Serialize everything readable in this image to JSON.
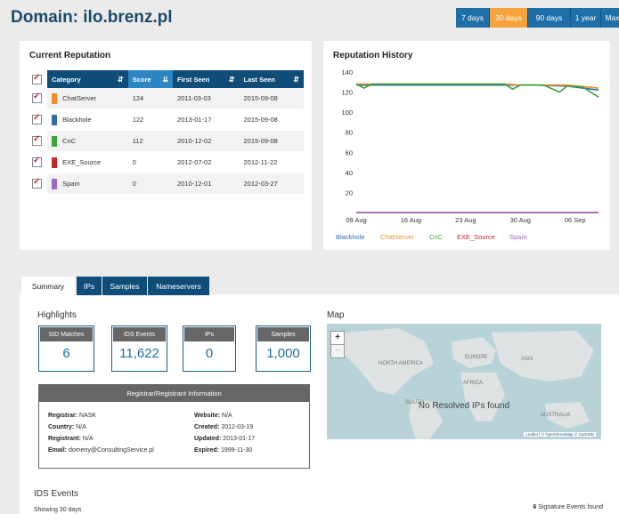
{
  "header": {
    "title": "Domain: ilo.brenz.pl",
    "ranges": [
      "7 days",
      "30 days",
      "90 days",
      "1 year",
      "Max"
    ],
    "active_range": "30 days"
  },
  "reputation": {
    "title": "Current Reputation",
    "columns": [
      "Category",
      "Score",
      "First Seen",
      "Last Seen"
    ],
    "rows": [
      {
        "category": "ChatServer",
        "score": "124",
        "first_seen": "2011-03-03",
        "last_seen": "2015-09-08",
        "color": "#f28c28"
      },
      {
        "category": "Blackhole",
        "score": "122",
        "first_seen": "2013-01-17",
        "last_seen": "2015-09-08",
        "color": "#2c6fab"
      },
      {
        "category": "CnC",
        "score": "112",
        "first_seen": "2010-12-02",
        "last_seen": "2015-09-08",
        "color": "#3aa43a"
      },
      {
        "category": "EXE_Source",
        "score": "0",
        "first_seen": "2012-07-02",
        "last_seen": "2012-11-22",
        "color": "#c0282d"
      },
      {
        "category": "Spam",
        "score": "0",
        "first_seen": "2010-12-01",
        "last_seen": "2012-03-27",
        "color": "#9b6ac0"
      }
    ]
  },
  "chart_data": {
    "type": "line",
    "title": "Reputation History",
    "ylim": [
      0,
      140
    ],
    "yticks": [
      20,
      40,
      60,
      80,
      100,
      120,
      140
    ],
    "x_ticks": [
      "09 Aug",
      "16 Aug",
      "23 Aug",
      "30 Aug",
      "06 Sep"
    ],
    "x_domain": [
      0,
      31
    ],
    "x_tick_positions": [
      0,
      7,
      14,
      21,
      28
    ],
    "series": [
      {
        "name": "Blackhole",
        "color": "#2c6fab",
        "points": [
          [
            0,
            127
          ],
          [
            2,
            127
          ],
          [
            19,
            127
          ],
          [
            23,
            127
          ],
          [
            27,
            126
          ],
          [
            31,
            122
          ]
        ]
      },
      {
        "name": "ChatServer",
        "color": "#f28c28",
        "points": [
          [
            0,
            128
          ],
          [
            19,
            128
          ],
          [
            21,
            127
          ],
          [
            27,
            127
          ],
          [
            31,
            124
          ]
        ]
      },
      {
        "name": "CnC",
        "color": "#3aa43a",
        "points": [
          [
            0,
            128
          ],
          [
            1,
            124
          ],
          [
            2,
            128
          ],
          [
            19,
            128
          ],
          [
            20,
            123
          ],
          [
            21,
            127
          ],
          [
            24,
            127
          ],
          [
            26,
            120
          ],
          [
            27,
            126
          ],
          [
            29,
            125
          ],
          [
            31,
            115
          ]
        ]
      },
      {
        "name": "EXE_Source",
        "color": "#c0282d",
        "points": [
          [
            0,
            0
          ],
          [
            31,
            0
          ]
        ]
      },
      {
        "name": "Spam",
        "color": "#9b6ac0",
        "points": [
          [
            0,
            0
          ],
          [
            31,
            0
          ]
        ]
      }
    ]
  },
  "tabs": [
    "Summary",
    "IPs",
    "Samples",
    "Nameservers"
  ],
  "highlights": {
    "title": "Highlights",
    "stats": [
      {
        "label": "SID Matches",
        "value": "6"
      },
      {
        "label": "IDS Events",
        "value": "11,622"
      },
      {
        "label": "IPs",
        "value": "0"
      },
      {
        "label": "Samples",
        "value": "1,000"
      }
    ]
  },
  "registrar": {
    "title": "Registrar/Registrant Information",
    "left": [
      {
        "k": "Registrar:",
        "v": "NASK"
      },
      {
        "k": "Country:",
        "v": "N/A"
      },
      {
        "k": "Registrant:",
        "v": "N/A"
      },
      {
        "k": "Email:",
        "v": "domeny@ConsultingService.pl"
      }
    ],
    "right": [
      {
        "k": "Website:",
        "v": "N/A"
      },
      {
        "k": "Created:",
        "v": "2012-03-19"
      },
      {
        "k": "Updated:",
        "v": "2013-01-17"
      },
      {
        "k": "Expired:",
        "v": "1999-11-30"
      }
    ]
  },
  "map": {
    "title": "Map",
    "message": "No Resolved IPs found",
    "zoom_in": "+",
    "zoom_out": "−",
    "attribution": "Leaflet | © OpenStreetMap © CartoDB",
    "labels": [
      "NORTH AMERICA",
      "EUROPE",
      "ASIA",
      "AFRICA",
      "SOUTH",
      "AUSTRALIA"
    ]
  },
  "ids": {
    "title": "IDS Events",
    "showing": "Showing 30 days",
    "signature_count": "6",
    "signature_label": "Signature Events found"
  }
}
